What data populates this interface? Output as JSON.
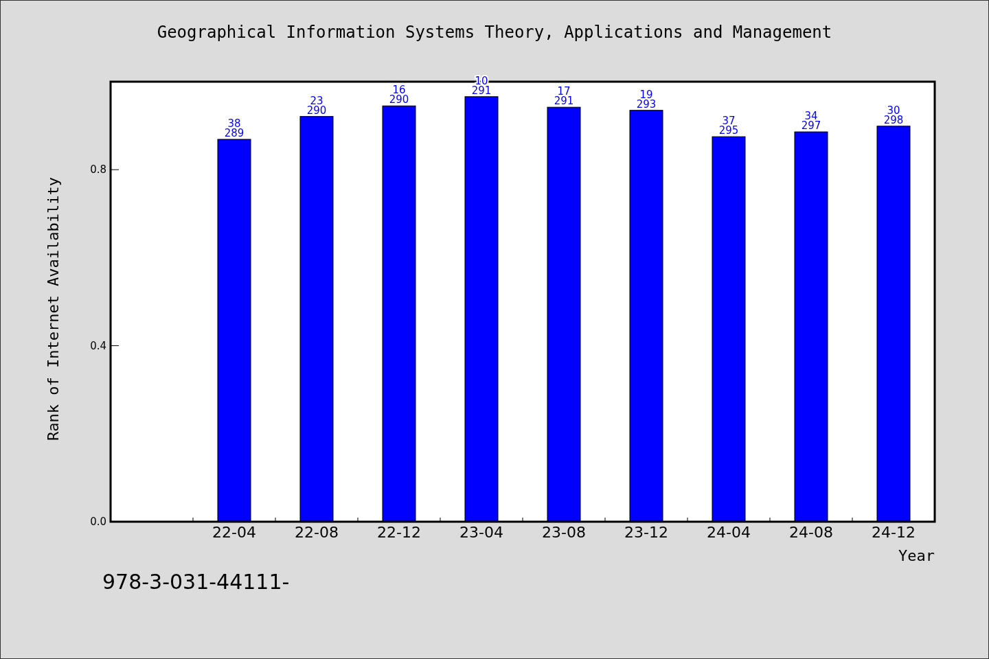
{
  "title": "Geographical Information Systems Theory, Applications and Management",
  "chart_data": {
    "type": "bar",
    "xlabel": "Year",
    "ylabel": "Rank of Internet Availability",
    "categories": [
      "22-04",
      "22-08",
      "22-12",
      "23-04",
      "23-08",
      "23-12",
      "24-04",
      "24-08",
      "24-12"
    ],
    "series": [
      {
        "color": "#0000ff",
        "values": [
          0.869,
          0.921,
          0.945,
          0.966,
          0.942,
          0.935,
          0.875,
          0.886,
          0.899
        ]
      }
    ],
    "ylim": [
      0,
      1
    ],
    "yticks": [
      {
        "value": 0,
        "label": "0.0"
      },
      {
        "value": 0.4,
        "label": "0.4"
      },
      {
        "value": 0.8,
        "label": "0.8"
      }
    ],
    "value_labels": [
      [
        "38",
        "289"
      ],
      [
        "23",
        "290"
      ],
      [
        "16",
        "290"
      ],
      [
        "10",
        "291"
      ],
      [
        "17",
        "291"
      ],
      [
        "19",
        "293"
      ],
      [
        "37",
        "295"
      ],
      [
        "34",
        "297"
      ],
      [
        "30",
        "298"
      ]
    ]
  },
  "footer": "978-3-031-44111-"
}
